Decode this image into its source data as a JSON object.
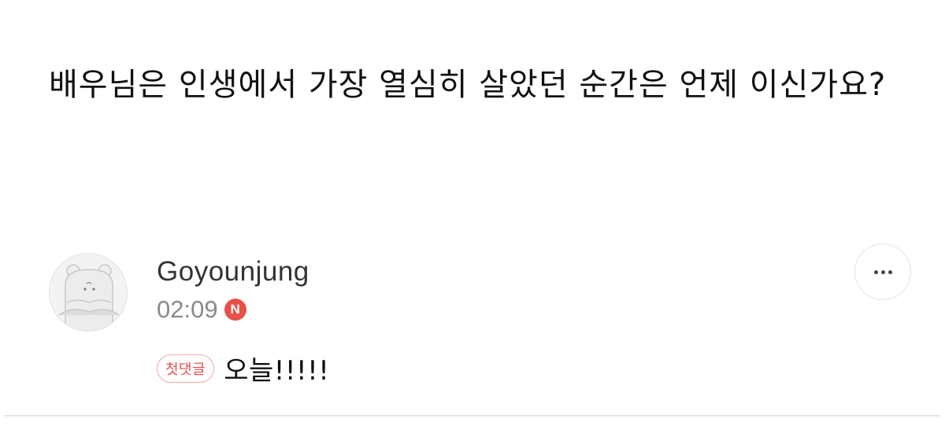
{
  "question": {
    "text": "배우님은 인생에서 가장 열심히 살았던 순간은 언제 이신가요?"
  },
  "comment": {
    "author": "Goyounjung",
    "time": "02:09",
    "new_badge": "N",
    "first_comment_badge": "첫댓글",
    "text": "오늘!!!!!",
    "avatar_icon": "hamster-avatar-icon",
    "more_icon": "more-horizontal-icon"
  },
  "colors": {
    "badge_red": "#e8504a",
    "badge_border": "#f2a6a6",
    "meta_gray": "#8a8a8a"
  }
}
